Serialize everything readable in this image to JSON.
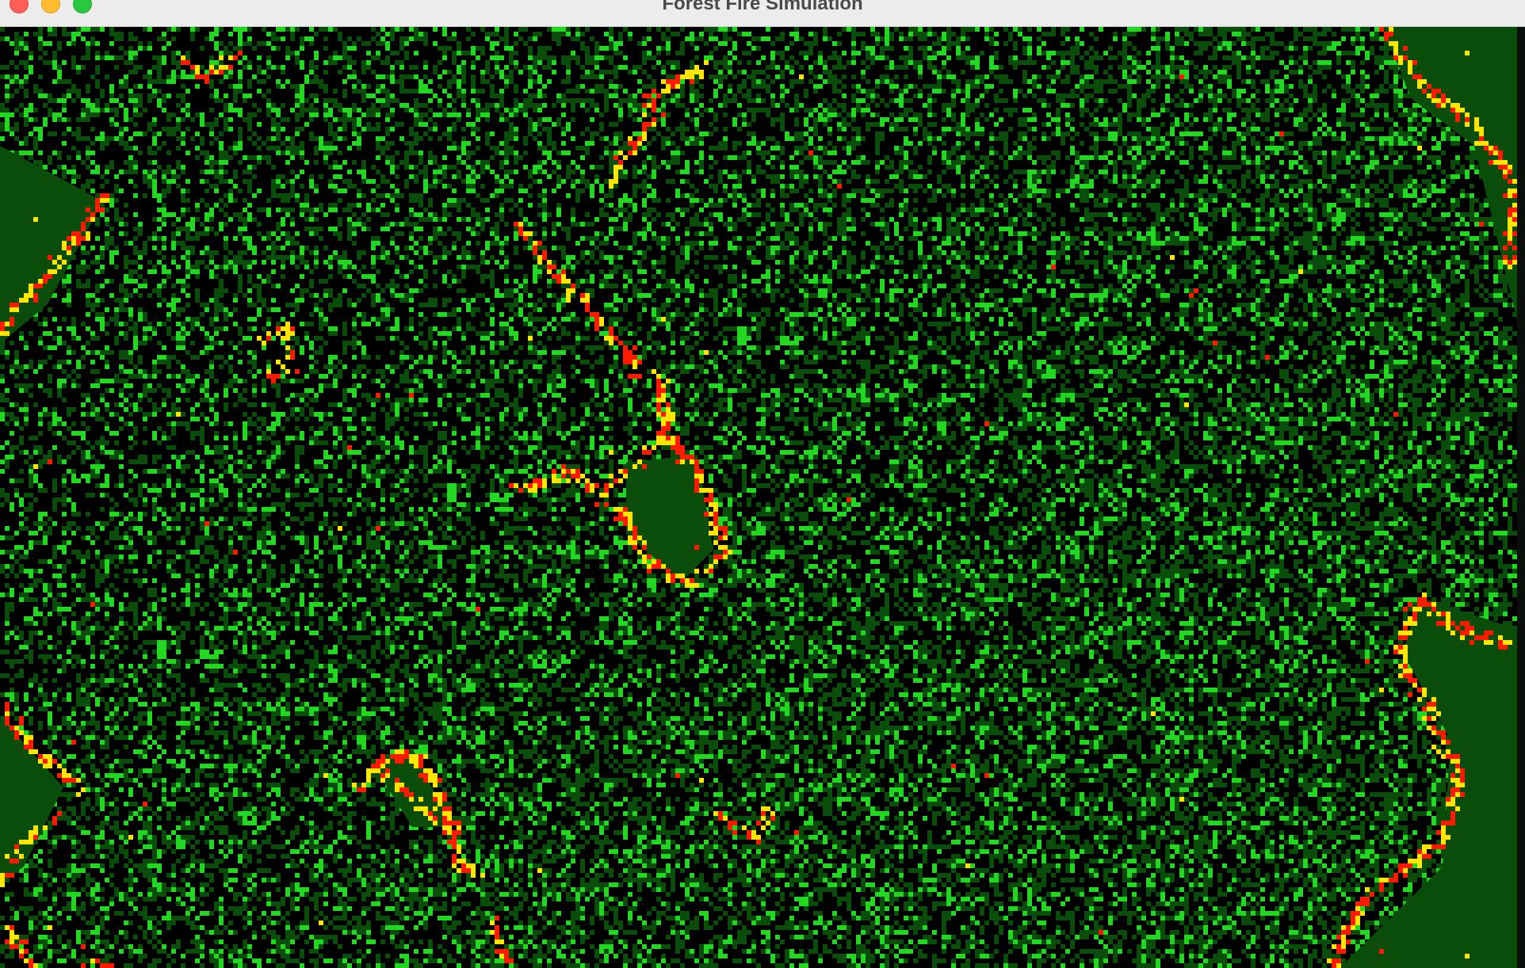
{
  "window": {
    "title": "Forest Fire Simulation"
  },
  "controls": {
    "close_icon": "close-icon",
    "minimize_icon": "minimize-icon",
    "zoom_icon": "zoom-icon"
  },
  "colors": {
    "empty": "#000000",
    "tree": "#0a4d0a",
    "growing": "#22d622",
    "burning": "#ff1a00",
    "ember": "#ffe600",
    "titlebar": "#ececec"
  },
  "grid": {
    "tree_density": 0.42,
    "bright_density": 0.14
  }
}
